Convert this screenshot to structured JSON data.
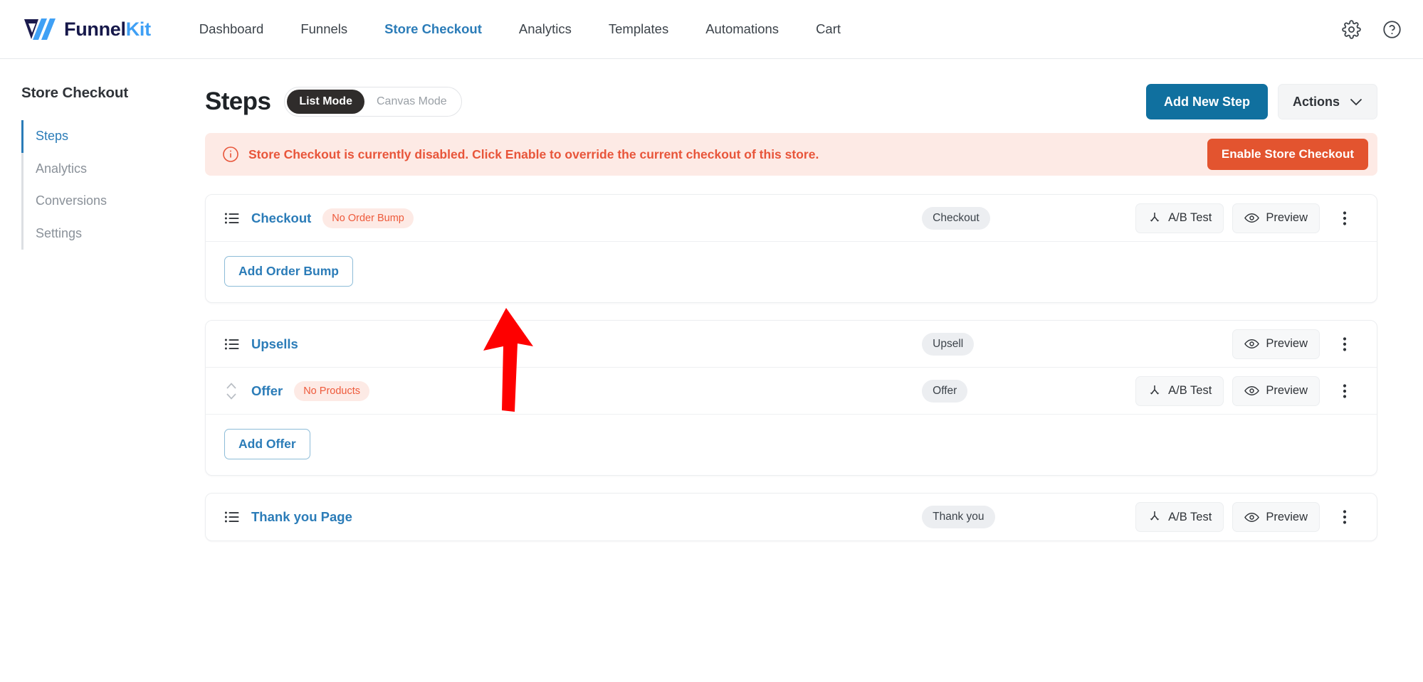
{
  "header": {
    "logo": {
      "name": "funnelkit-logo",
      "text_part1": "Funnel",
      "text_part2": "Kit"
    },
    "nav": [
      {
        "label": "Dashboard",
        "active": false
      },
      {
        "label": "Funnels",
        "active": false
      },
      {
        "label": "Store Checkout",
        "active": true
      },
      {
        "label": "Analytics",
        "active": false
      },
      {
        "label": "Templates",
        "active": false
      },
      {
        "label": "Automations",
        "active": false
      },
      {
        "label": "Cart",
        "active": false
      }
    ],
    "icons": [
      {
        "name": "gear-icon"
      },
      {
        "name": "help-icon"
      }
    ]
  },
  "sidebar": {
    "title": "Store Checkout",
    "items": [
      {
        "label": "Steps",
        "active": true
      },
      {
        "label": "Analytics",
        "active": false
      },
      {
        "label": "Conversions",
        "active": false
      },
      {
        "label": "Settings",
        "active": false
      }
    ]
  },
  "main": {
    "page_title": "Steps",
    "mode_toggle": {
      "list_mode": "List Mode",
      "canvas_mode": "Canvas Mode",
      "selected": "List Mode"
    },
    "add_new_step": "Add New Step",
    "actions": "Actions",
    "notice": {
      "text": "Store Checkout is currently disabled. Click Enable to override the current checkout of this store.",
      "button": "Enable Store Checkout",
      "icon": "info-circle-icon",
      "color": "#e8553a",
      "bg": "#fdeae5"
    },
    "labels": {
      "ab_test": "A/B Test",
      "preview": "Preview"
    },
    "cards": [
      {
        "rows": [
          {
            "handle": "list-handle-icon",
            "title": "Checkout",
            "badge": "No Order Bump",
            "type": "Checkout",
            "has_ab_test": true,
            "has_preview": true
          }
        ],
        "action_button": "Add Order Bump"
      },
      {
        "rows": [
          {
            "handle": "list-handle-icon",
            "title": "Upsells",
            "badge": "",
            "type": "Upsell",
            "has_ab_test": false,
            "has_preview": true
          },
          {
            "handle": "sort-arrows-icon",
            "title": "Offer",
            "badge": "No Products",
            "type": "Offer",
            "has_ab_test": true,
            "has_preview": true
          }
        ],
        "action_button": "Add Offer"
      },
      {
        "rows": [
          {
            "handle": "list-handle-icon",
            "title": "Thank you Page",
            "badge": "",
            "type": "Thank you",
            "has_ab_test": true,
            "has_preview": true
          }
        ],
        "action_button": ""
      }
    ]
  },
  "annotation": {
    "arrow": {
      "name": "red-arrow-annotation",
      "color": "#fe0000",
      "points_to": "Checkout",
      "direction": "up"
    }
  },
  "colors": {
    "link_blue": "#2b7cb8",
    "primary_blue": "#10709f",
    "danger_orange": "#e3542f",
    "badge_grey": "#eceef1"
  }
}
